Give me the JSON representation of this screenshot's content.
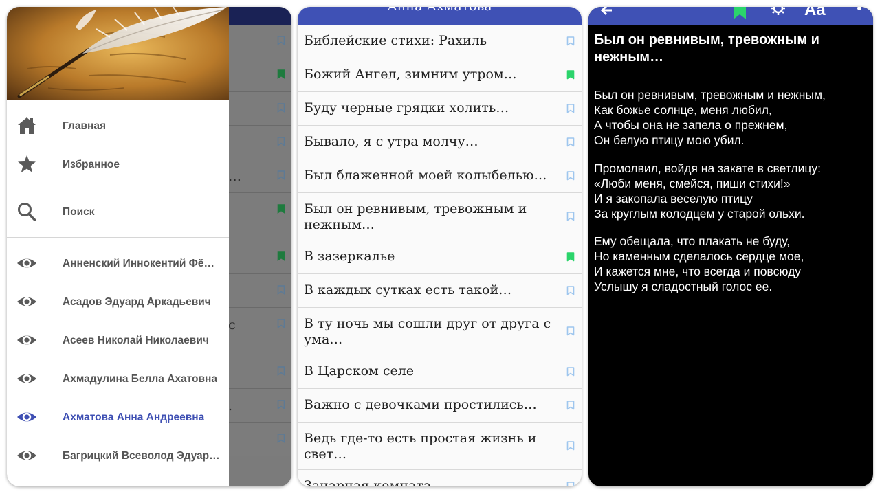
{
  "colors": {
    "primary": "#3f51b5",
    "active_nav": "#3e4fb3",
    "bookmark_on": "#2bd46b",
    "bookmark_off": "#9ec6ee"
  },
  "panel1": {
    "drawer": {
      "header_image": "quill-pen-parchment-image",
      "main_items": [
        {
          "icon": "home-icon",
          "label": "Главная"
        },
        {
          "icon": "star-icon",
          "label": "Избранное"
        }
      ],
      "search_item": {
        "icon": "search-icon",
        "label": "Поиск"
      },
      "authors": [
        {
          "icon": "eye-icon",
          "label": "Анненский Иннокентий Фё…",
          "active": false
        },
        {
          "icon": "eye-icon",
          "label": "Асадов Эдуард Аркадьевич",
          "active": false
        },
        {
          "icon": "eye-icon",
          "label": "Асеев Николай Николаевич",
          "active": false
        },
        {
          "icon": "eye-icon",
          "label": "Ахмадулина Белла Ахатовна",
          "active": false
        },
        {
          "icon": "eye-icon",
          "label": "Ахматова Анна Андреевна",
          "active": true
        },
        {
          "icon": "eye-icon",
          "label": "Багрицкий Всеволод Эдуар…",
          "active": false
        }
      ]
    },
    "background_rows": [
      {
        "frag": "",
        "bookmarked": false
      },
      {
        "frag": "",
        "bookmarked": true
      },
      {
        "frag": "",
        "bookmarked": false
      },
      {
        "frag": "",
        "bookmarked": false
      },
      {
        "frag": "…",
        "bookmarked": false
      },
      {
        "frag": "",
        "bookmarked": true
      },
      {
        "frag": "",
        "bookmarked": true
      },
      {
        "frag": "",
        "bookmarked": false
      },
      {
        "frag": "с",
        "bookmarked": false
      },
      {
        "frag": "",
        "bookmarked": false
      },
      {
        "frag": ".",
        "bookmarked": false
      },
      {
        "frag": "",
        "bookmarked": false
      }
    ]
  },
  "panel2": {
    "app_title": "Анна Ахматова",
    "poems": [
      {
        "title": "Библейские стихи: Рахиль",
        "bookmarked": false
      },
      {
        "title": "Божий Ангел, зимним утром…",
        "bookmarked": true
      },
      {
        "title": "Буду черные грядки холить…",
        "bookmarked": false
      },
      {
        "title": "Бывало, я с утра молчу…",
        "bookmarked": false
      },
      {
        "title": "Был блаженной моей колыбелью…",
        "bookmarked": false
      },
      {
        "title": "Был он ревнивым, тревожным и нежным…",
        "bookmarked": false
      },
      {
        "title": "В зазеркалье",
        "bookmarked": true
      },
      {
        "title": "В каждых сутках есть такой…",
        "bookmarked": false
      },
      {
        "title": "В ту ночь мы сошли друг от друга с ума…",
        "bookmarked": false
      },
      {
        "title": "В Царском селе",
        "bookmarked": false
      },
      {
        "title": "Важно с девочками простились…",
        "bookmarked": false
      },
      {
        "title": "Ведь где-то есть простая жизнь и свет…",
        "bookmarked": false
      },
      {
        "title": "Зачарная комната",
        "bookmarked": false
      }
    ]
  },
  "panel3": {
    "toolbar_icons": [
      "back-arrow-icon",
      "bookmark-icon",
      "brightness-icon",
      "font-size-icon",
      "more-icon"
    ],
    "poem_title": "Был он ревнивым, тревожным и нежным…",
    "stanzas": [
      [
        "Был он ревнивым, тревожным и нежным,",
        "Как божье солнце, меня любил,",
        "А чтобы она не запела о прежнем,",
        "Он белую птицу мою убил."
      ],
      [
        "Промолвил, войдя на закате в светлицу:",
        "«Люби меня, смейся, пиши стихи!»",
        "И я закопала веселую птицу",
        "За круглым колодцем у старой ольхи."
      ],
      [
        "Ему обещала, что плакать не буду,",
        "Но каменным сделалось сердце мое,",
        "И кажется мне, что всегда и повсюду",
        "Услышу я сладостный голос ее."
      ]
    ]
  }
}
